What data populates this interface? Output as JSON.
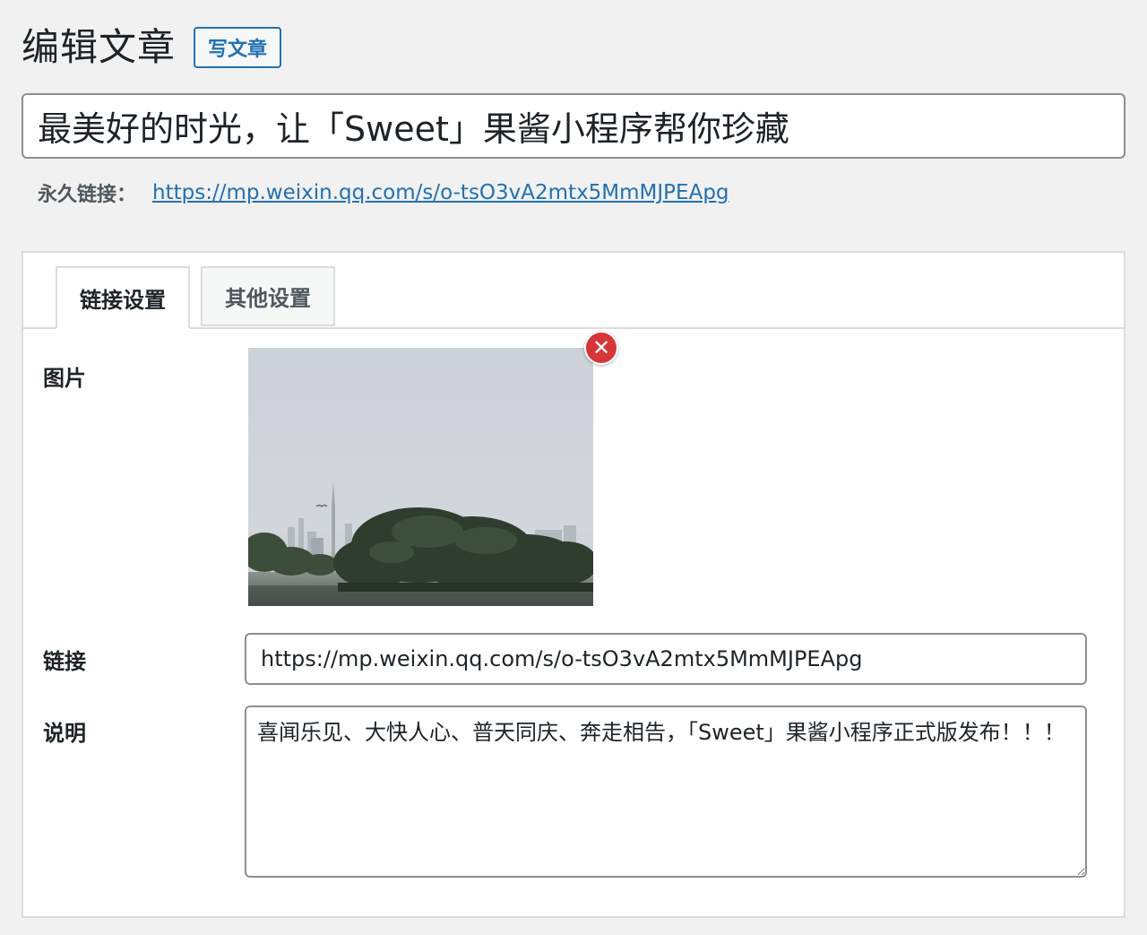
{
  "header": {
    "title": "编辑文章",
    "add_new_label": "写文章"
  },
  "post": {
    "title": "最美好的时光，让「Sweet」果酱小程序帮你珍藏"
  },
  "permalink": {
    "label": "永久链接：",
    "url": "https://mp.weixin.qq.com/s/o-tsO3vA2mtx5MmMJPEApg"
  },
  "tabs": [
    {
      "label": "链接设置",
      "active": true
    },
    {
      "label": "其他设置",
      "active": false
    }
  ],
  "fields": {
    "image_label": "图片",
    "link_label": "链接",
    "link_value": "https://mp.weixin.qq.com/s/o-tsO3vA2mtx5MmMJPEApg",
    "desc_label": "说明",
    "desc_value": "喜闻乐见、大快人心、普天同庆、奔走相告，「Sweet」果酱小程序正式版发布！！！"
  },
  "icons": {
    "remove": "close-icon",
    "resize": "resize-handle-icon"
  },
  "colors": {
    "accent": "#2271b1",
    "remove": "#d63638",
    "background": "#f1f1f1"
  }
}
